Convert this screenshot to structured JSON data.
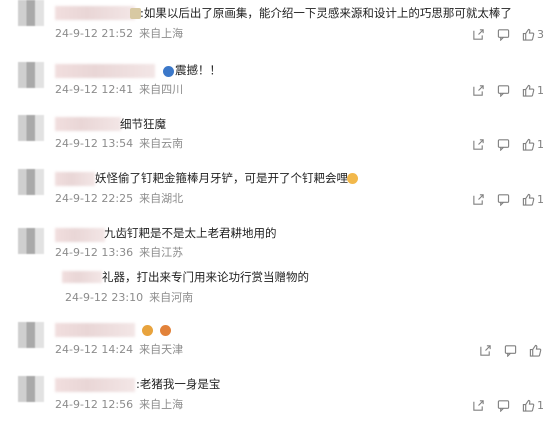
{
  "comments": [
    {
      "name_suffix": ":",
      "text": "如果以后出了原画集，能介绍一下灵感来源和设计上的巧思那可就太棒了",
      "date": "24-9-12 21:52",
      "location": "来自上海",
      "likes": "3",
      "emojis": [
        {
          "name": "blur-emoji-icon",
          "color": "#d8c9a3"
        }
      ]
    },
    {
      "name_suffix": "",
      "text": "震撼！！",
      "date": "24-9-12 12:41",
      "location": "来自四川",
      "likes": "1",
      "emojis": [
        {
          "name": "shocked-emoji-icon",
          "color": "#3b78c9"
        }
      ]
    },
    {
      "name_suffix": "",
      "text": "细节狂魔",
      "date": "24-9-12 13:54",
      "location": "来自云南",
      "likes": "1",
      "emojis": []
    },
    {
      "name_suffix": "",
      "text": "妖怪偷了钉耙金箍棒月牙铲，可是开了个钉耙会哩",
      "date": "24-9-12 22:25",
      "location": "来自湖北",
      "likes": "1",
      "emojis": [
        {
          "name": "smile-emoji-icon",
          "color": "#f2b84b"
        }
      ]
    },
    {
      "name_suffix": "",
      "text": "九齿钉耙是不是太上老君耕地用的",
      "date": "24-9-12 13:36",
      "location": "来自江苏",
      "likes": "",
      "emojis": []
    },
    {
      "name_suffix": "",
      "text": "礼器，打出来专门用来论功行赏当赠物的",
      "date": "24-9-12 23:10",
      "location": "来自河南",
      "likes": "",
      "emojis": []
    },
    {
      "name_suffix": "",
      "text": "",
      "date": "24-9-12 14:24",
      "location": "来自天津",
      "likes": "",
      "emojis": [
        {
          "name": "crown-emoji-icon",
          "color": "#e8a33d"
        },
        {
          "name": "face-emoji-icon",
          "color": "#e2823a"
        }
      ]
    },
    {
      "name_suffix": ":",
      "text": "老猪我一身是宝",
      "date": "24-9-12 12:56",
      "location": "来自上海",
      "likes": "1",
      "emojis": []
    }
  ]
}
